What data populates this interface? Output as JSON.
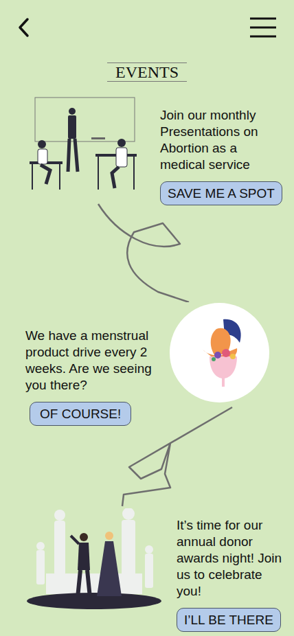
{
  "header": {
    "title": "EVENTS"
  },
  "events": [
    {
      "kind": "meeting",
      "text": "Join our monthly Presentations on Abortion as a medical service",
      "button": "SAVE ME A SPOT"
    },
    {
      "kind": "drive",
      "text": "We have a menstrual product drive every 2 weeks. Are we seeing you there?",
      "button": "OF COURSE!"
    },
    {
      "kind": "awards",
      "text": "It’s time for our annual donor awards night! Join us to celebrate you!",
      "button": "I’LL BE THERE"
    }
  ]
}
